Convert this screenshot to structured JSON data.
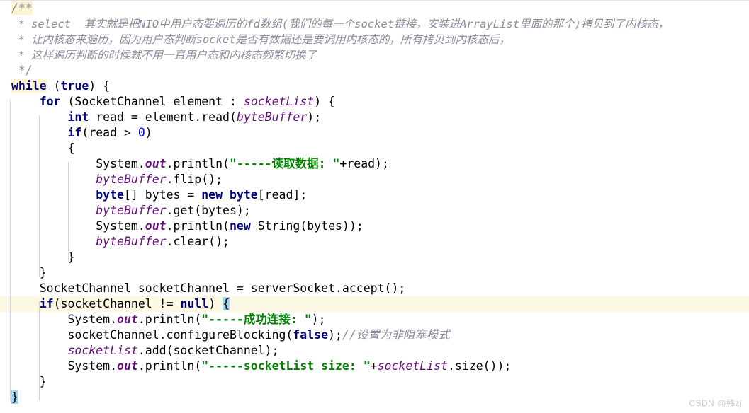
{
  "editor": {
    "language": "java",
    "background": "#ffffff",
    "line_height_px": 22,
    "font_size_px": 16.5,
    "colors": {
      "keyword": "#000080",
      "field": "#660e7a",
      "string": "#008000",
      "number": "#0000ff",
      "comment": "#8c8c9e",
      "plain_text": "#000000",
      "current_line_highlight": "#fdf8e3",
      "token_highlight": "#fcf3cf",
      "brace_match_highlight": "#a8d8f0",
      "indent_guide": "#d4d4d8",
      "watermark": "#c9c9c9"
    }
  },
  "code": {
    "line_01": {
      "t1": "/**"
    },
    "line_02": {
      "t1": " * select  其实就是把NIO中用户态要遍历的fd数组(我们的每一个socket链接，安装进ArrayList里面的那个)拷贝到了内核态，"
    },
    "line_03": {
      "t1": " * 让内核态来遍历，因为用户态判断socket是否有数据还是要调用内核态的，所有拷贝到内核态后，"
    },
    "line_04": {
      "t1": " * 这样遍历判断的时候就不用一直用户态和内核态频繁切换了"
    },
    "line_05": {
      "t1": " */"
    },
    "line_06": {
      "t1": "while",
      "t2": " (",
      "t3": "true",
      "t4": ") {"
    },
    "line_07": {
      "indent": "    ",
      "t1": "for",
      "t2": " (SocketChannel element : ",
      "t3": "socketList",
      "t4": ") {"
    },
    "line_08": {
      "indent": "        ",
      "t1": "int",
      "t2": " read = element.read(",
      "t3": "byteBuffer",
      "t4": ");"
    },
    "line_09": {
      "indent": "        ",
      "t1": "if",
      "t2": "(read > ",
      "t3": "0",
      "t4": ")"
    },
    "line_10": {
      "indent": "        ",
      "t1": "{"
    },
    "line_11": {
      "indent": "            ",
      "t1": "System.",
      "t2": "out",
      "t3": ".println(",
      "t4": "\"-----读取数据: \"",
      "t5": "+read);"
    },
    "line_12": {
      "indent": "            ",
      "t1": "byteBuffer",
      "t2": ".flip();"
    },
    "line_13": {
      "indent": "            ",
      "t1": "byte",
      "t2": "[] bytes = ",
      "t3": "new",
      "t4": " ",
      "t5": "byte",
      "t6": "[read];"
    },
    "line_14": {
      "indent": "            ",
      "t1": "byteBuffer",
      "t2": ".get(bytes);"
    },
    "line_15": {
      "indent": "            ",
      "t1": "System.",
      "t2": "out",
      "t3": ".println(",
      "t4": "new",
      "t5": " String(bytes));"
    },
    "line_16": {
      "indent": "            ",
      "t1": "byteBuffer",
      "t2": ".clear();"
    },
    "line_17": {
      "indent": "        ",
      "t1": "}"
    },
    "line_18": {
      "indent": "    ",
      "t1": "}"
    },
    "line_19": {
      "indent": "    ",
      "t1": "SocketChannel socketChannel = serverSocket.accept();"
    },
    "line_20": {
      "indent": "    ",
      "t1": "if",
      "t2": "(socketChannel != ",
      "t3": "null",
      "t4": ") ",
      "t5": "{"
    },
    "line_21": {
      "indent": "        ",
      "t1": "System.",
      "t2": "out",
      "t3": ".println(",
      "t4": "\"-----成功连接: \"",
      "t5": ");"
    },
    "line_22": {
      "indent": "        ",
      "t1": "socketChannel.configureBlocking(",
      "t2": "false",
      "t3": ");",
      "t4": "//设置为非阻塞模式"
    },
    "line_23": {
      "indent": "        ",
      "t1": "socketList",
      "t2": ".add(socketChannel);"
    },
    "line_24": {
      "indent": "        ",
      "t1": "System.",
      "t2": "out",
      "t3": ".println(",
      "t4": "\"-----socketList size: \"",
      "t5": "+",
      "t6": "socketList",
      "t7": ".size());"
    },
    "line_25": {
      "indent": "    ",
      "t1": "}"
    },
    "line_26": {
      "t1": "}"
    }
  },
  "watermark": {
    "text": "CSDN @韩zj"
  }
}
